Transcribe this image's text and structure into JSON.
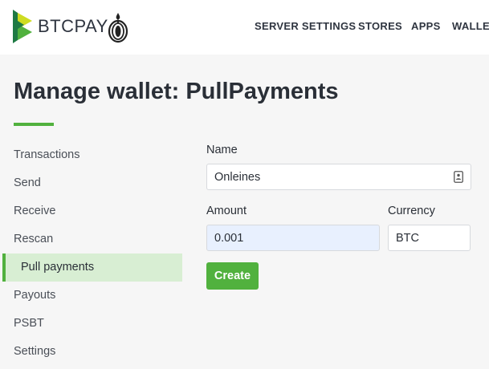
{
  "header": {
    "brand": "BTCPAY",
    "nav": {
      "server_settings": "SERVER SETTINGS",
      "stores": "STORES",
      "apps": "APPS",
      "wallets": "WALLETS"
    }
  },
  "page": {
    "title": "Manage wallet: PullPayments"
  },
  "sidebar": {
    "items": [
      {
        "label": "Transactions"
      },
      {
        "label": "Send"
      },
      {
        "label": "Receive"
      },
      {
        "label": "Rescan"
      },
      {
        "label": "Pull payments",
        "active": true
      },
      {
        "label": "Payouts"
      },
      {
        "label": "PSBT"
      },
      {
        "label": "Settings"
      }
    ]
  },
  "form": {
    "name_label": "Name",
    "name_value": "Onleines",
    "amount_label": "Amount",
    "amount_value": "0.001",
    "currency_label": "Currency",
    "currency_value": "BTC",
    "create_label": "Create"
  },
  "colors": {
    "accent": "#51b13e",
    "active_bg": "#d8eed3",
    "autofill_bg": "#e8f0fe"
  },
  "icons": {
    "logo": "btcpay-logo-icon",
    "tor": "tor-onion-icon",
    "name_field": "contact-card-icon"
  }
}
